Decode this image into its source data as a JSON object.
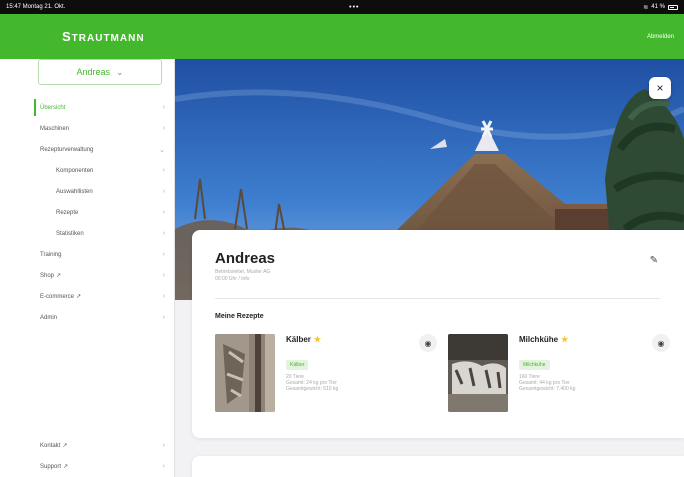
{
  "status_bar": {
    "time_date": "15:47  Montag 21. Okt.",
    "battery": "41 %"
  },
  "header": {
    "brand_prefix": "S",
    "brand_rest": "TRAUTMANN",
    "logout_label": "Abmelden"
  },
  "sidebar": {
    "selected_user": "Andreas",
    "items": [
      {
        "label": "Übersicht"
      },
      {
        "label": "Maschinen"
      },
      {
        "label": "Rezepturverwaltung"
      },
      {
        "label": "Komponenten"
      },
      {
        "label": "Auswahllisten"
      },
      {
        "label": "Rezepte"
      },
      {
        "label": "Statistiken"
      },
      {
        "label": "Training"
      },
      {
        "label": "Shop"
      },
      {
        "label": "E-commerce"
      },
      {
        "label": "Admin"
      }
    ],
    "bottom_items": [
      {
        "label": "Kontakt"
      },
      {
        "label": "Support"
      }
    ]
  },
  "profile": {
    "name": "Andreas",
    "meta_line1": "Betriebsleiter, Muster AG",
    "meta_line2": "00:00 Uhr / Info"
  },
  "recipes": {
    "section_title": "Meine Rezepte",
    "items": [
      {
        "title": "Kälber",
        "tag": "Kälber",
        "line1": "20 Tiere",
        "line2": "Gesamt: 24 kg pro Tier",
        "line3": "Gesamtgewicht: 510 kg"
      },
      {
        "title": "Milchkühe",
        "tag": "Milchkühe",
        "line1": "160 Tiere",
        "line2": "Gesamt: 44 kg pro Tier",
        "line3": "Gesamtgewicht: 7.400 kg"
      }
    ]
  },
  "icons": {
    "close": "×",
    "edit": "✎",
    "eye": "◉",
    "star": "★",
    "chevron": "›",
    "external": "↗",
    "dropdown": "⌄"
  },
  "colors": {
    "brand_green": "#43b82d",
    "star_yellow": "#f3c52b"
  }
}
